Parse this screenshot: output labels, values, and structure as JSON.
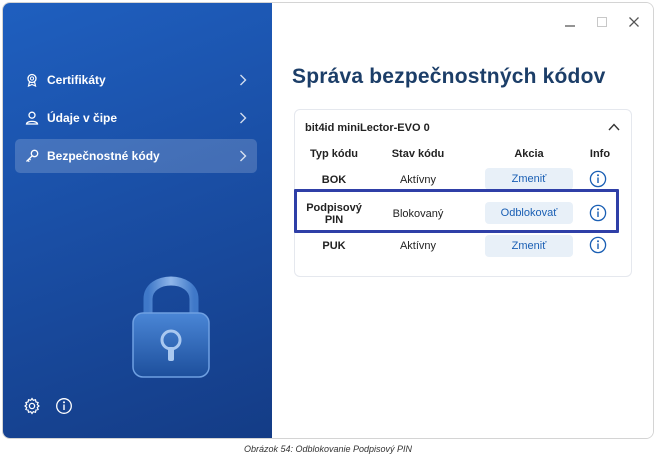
{
  "sidebar": {
    "items": [
      {
        "label": "Certifikáty",
        "icon": "certificate-icon",
        "active": false
      },
      {
        "label": "Údaje v čipe",
        "icon": "person-icon",
        "active": false
      },
      {
        "label": "Bezpečnostné kódy",
        "icon": "key-icon",
        "active": true
      }
    ],
    "bottom_icons": [
      "gear-icon",
      "info-icon"
    ]
  },
  "main": {
    "title": "Správa bezpečnostných kódov",
    "card": {
      "device": "bit4id miniLector-EVO 0",
      "headers": [
        "Typ kódu",
        "Stav kódu",
        "Akcia",
        "Info"
      ],
      "rows": [
        {
          "code": "BOK",
          "status": "Aktívny",
          "action": "Zmeniť"
        },
        {
          "code": "Podpisový PIN",
          "status": "Blokovaný",
          "action": "Odblokovať"
        },
        {
          "code": "PUK",
          "status": "Aktívny",
          "action": "Zmeniť"
        }
      ]
    }
  },
  "caption": "Obrázok 54: Odblokovanie Podpisový PIN",
  "colors": {
    "sidebar_blue": "#1a4fa6",
    "title_navy": "#1c3e68",
    "highlight_border": "#2f3fa7",
    "action_button_bg": "#e8f0f8"
  }
}
